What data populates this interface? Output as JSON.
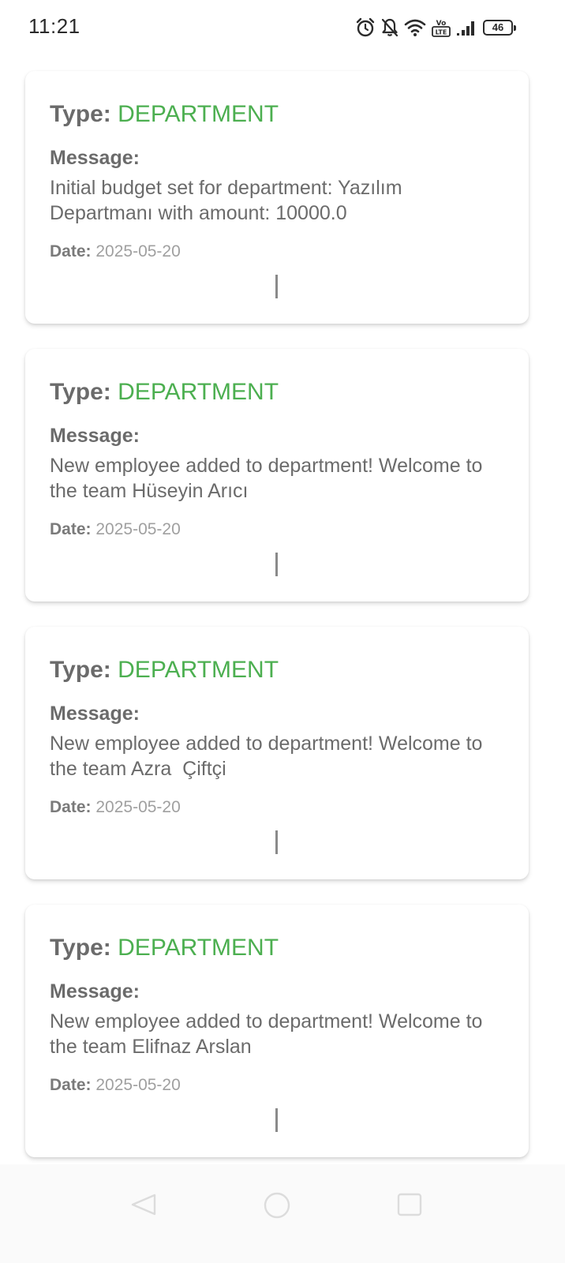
{
  "status_bar": {
    "time": "11:21",
    "icons": [
      "alarm-icon",
      "bell-off-icon",
      "wifi-icon",
      "volte-icon",
      "signal-icon"
    ],
    "battery_level": "46"
  },
  "colors": {
    "type_value": "#4caf50",
    "label_text": "#6b6b6b",
    "date_value": "#a0a0a0"
  },
  "cards": [
    {
      "type_label": "Type:",
      "type_value": "DEPARTMENT",
      "message_label": "Message:",
      "message": "Initial budget set for department: Yazılım Departmanı with amount: 10000.0",
      "date_label": "Date:",
      "date": "2025-05-20"
    },
    {
      "type_label": "Type:",
      "type_value": "DEPARTMENT",
      "message_label": "Message:",
      "message": "New employee added to department! Welcome to the team Hüseyin Arıcı",
      "date_label": "Date:",
      "date": "2025-05-20"
    },
    {
      "type_label": "Type:",
      "type_value": "DEPARTMENT",
      "message_label": "Message:",
      "message": "New employee added to department! Welcome to the team Azra  Çiftçi",
      "date_label": "Date:",
      "date": "2025-05-20"
    },
    {
      "type_label": "Type:",
      "type_value": "DEPARTMENT",
      "message_label": "Message:",
      "message": "New employee added to department! Welcome to the team Elifnaz Arslan",
      "date_label": "Date:",
      "date": "2025-05-20"
    }
  ],
  "nav_bar": {
    "buttons": [
      "back-icon",
      "home-icon",
      "recents-icon"
    ]
  }
}
